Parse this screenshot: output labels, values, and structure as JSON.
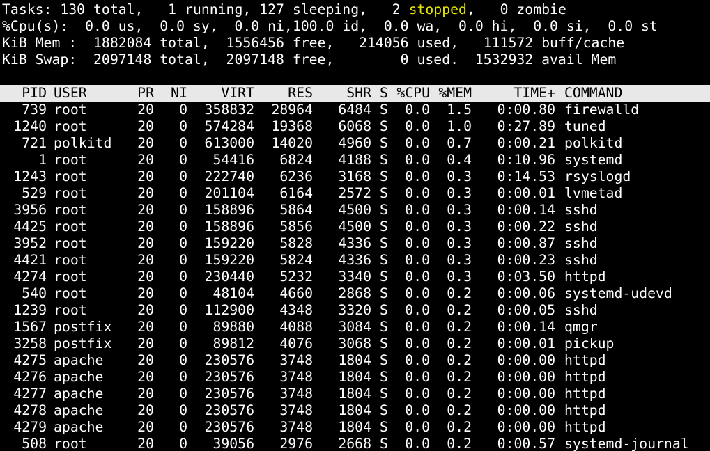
{
  "summary": {
    "tasks_prefix": "Tasks: 130 total,   1 running, 127 sleeping,   2 ",
    "tasks_stopped": "stopped",
    "tasks_suffix": ",   0 zombie",
    "cpu": "%Cpu(s):  0.0 us,  0.0 sy,  0.0 ni,100.0 id,  0.0 wa,  0.0 hi,  0.0 si,  0.0 st",
    "mem": "KiB Mem :  1882084 total,  1556456 free,   214056 used,   111572 buff/cache",
    "swap": "KiB Swap:  2097148 total,  2097148 free,        0 used.  1532932 avail Mem"
  },
  "colors": {
    "background": "#000000",
    "text": "#ffffff",
    "stopped": "#e6e600",
    "header_bar": "#e8e8e8"
  },
  "columns": [
    "PID",
    "USER",
    "PR",
    "NI",
    "VIRT",
    "RES",
    "SHR",
    "S",
    "%CPU",
    "%MEM",
    "TIME+",
    "COMMAND"
  ],
  "processes": [
    [
      "739",
      "root",
      "20",
      "0",
      "358832",
      "28964",
      "6484",
      "S",
      "0.0",
      "1.5",
      "0:00.80",
      "firewalld"
    ],
    [
      "1240",
      "root",
      "20",
      "0",
      "574284",
      "19368",
      "6068",
      "S",
      "0.0",
      "1.0",
      "0:27.89",
      "tuned"
    ],
    [
      "721",
      "polkitd",
      "20",
      "0",
      "613000",
      "14020",
      "4960",
      "S",
      "0.0",
      "0.7",
      "0:00.21",
      "polkitd"
    ],
    [
      "1",
      "root",
      "20",
      "0",
      "54416",
      "6824",
      "4188",
      "S",
      "0.0",
      "0.4",
      "0:10.96",
      "systemd"
    ],
    [
      "1243",
      "root",
      "20",
      "0",
      "222740",
      "6236",
      "3168",
      "S",
      "0.0",
      "0.3",
      "0:14.53",
      "rsyslogd"
    ],
    [
      "529",
      "root",
      "20",
      "0",
      "201104",
      "6164",
      "2572",
      "S",
      "0.0",
      "0.3",
      "0:00.01",
      "lvmetad"
    ],
    [
      "3956",
      "root",
      "20",
      "0",
      "158896",
      "5864",
      "4500",
      "S",
      "0.0",
      "0.3",
      "0:00.14",
      "sshd"
    ],
    [
      "4425",
      "root",
      "20",
      "0",
      "158896",
      "5856",
      "4500",
      "S",
      "0.0",
      "0.3",
      "0:00.22",
      "sshd"
    ],
    [
      "3952",
      "root",
      "20",
      "0",
      "159220",
      "5828",
      "4336",
      "S",
      "0.0",
      "0.3",
      "0:00.87",
      "sshd"
    ],
    [
      "4421",
      "root",
      "20",
      "0",
      "159220",
      "5824",
      "4336",
      "S",
      "0.0",
      "0.3",
      "0:00.23",
      "sshd"
    ],
    [
      "4274",
      "root",
      "20",
      "0",
      "230440",
      "5232",
      "3340",
      "S",
      "0.0",
      "0.3",
      "0:03.50",
      "httpd"
    ],
    [
      "540",
      "root",
      "20",
      "0",
      "48104",
      "4660",
      "2868",
      "S",
      "0.0",
      "0.2",
      "0:00.06",
      "systemd-udevd"
    ],
    [
      "1239",
      "root",
      "20",
      "0",
      "112900",
      "4348",
      "3320",
      "S",
      "0.0",
      "0.2",
      "0:00.05",
      "sshd"
    ],
    [
      "1567",
      "postfix",
      "20",
      "0",
      "89880",
      "4088",
      "3084",
      "S",
      "0.0",
      "0.2",
      "0:00.14",
      "qmgr"
    ],
    [
      "3258",
      "postfix",
      "20",
      "0",
      "89812",
      "4076",
      "3068",
      "S",
      "0.0",
      "0.2",
      "0:00.01",
      "pickup"
    ],
    [
      "4275",
      "apache",
      "20",
      "0",
      "230576",
      "3748",
      "1804",
      "S",
      "0.0",
      "0.2",
      "0:00.00",
      "httpd"
    ],
    [
      "4276",
      "apache",
      "20",
      "0",
      "230576",
      "3748",
      "1804",
      "S",
      "0.0",
      "0.2",
      "0:00.00",
      "httpd"
    ],
    [
      "4277",
      "apache",
      "20",
      "0",
      "230576",
      "3748",
      "1804",
      "S",
      "0.0",
      "0.2",
      "0:00.00",
      "httpd"
    ],
    [
      "4278",
      "apache",
      "20",
      "0",
      "230576",
      "3748",
      "1804",
      "S",
      "0.0",
      "0.2",
      "0:00.00",
      "httpd"
    ],
    [
      "4279",
      "apache",
      "20",
      "0",
      "230576",
      "3748",
      "1804",
      "S",
      "0.0",
      "0.2",
      "0:00.00",
      "httpd"
    ],
    [
      "508",
      "root",
      "20",
      "0",
      "39056",
      "2976",
      "2668",
      "S",
      "0.0",
      "0.2",
      "0:00.57",
      "systemd-journal"
    ]
  ]
}
